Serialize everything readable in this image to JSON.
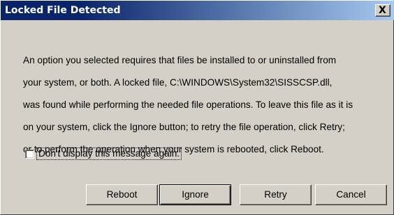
{
  "window": {
    "title": "Locked File Detected",
    "close_glyph": "X",
    "close_icon": "close-icon"
  },
  "message": {
    "lines": [
      "An option you selected requires that files be installed to or uninstalled from",
      "your system, or both. A locked file, C:\\WINDOWS\\System32\\SISSCSP.dll,",
      "was found while performing the needed file operations. To leave this file as it is",
      "on your system, click the Ignore button; to retry the file operation, click Retry;",
      "or to perform the operation when your system is rebooted, click Reboot."
    ]
  },
  "checkbox": {
    "label": "Don't display this message again.",
    "checked": false
  },
  "buttons": {
    "reboot": "Reboot",
    "ignore": "Ignore",
    "retry": "Retry",
    "cancel": "Cancel"
  },
  "colors": {
    "title_bar_start": "#0a246a",
    "title_bar_end": "#a6caf0",
    "face": "#d4d0c8",
    "text": "#000000"
  }
}
